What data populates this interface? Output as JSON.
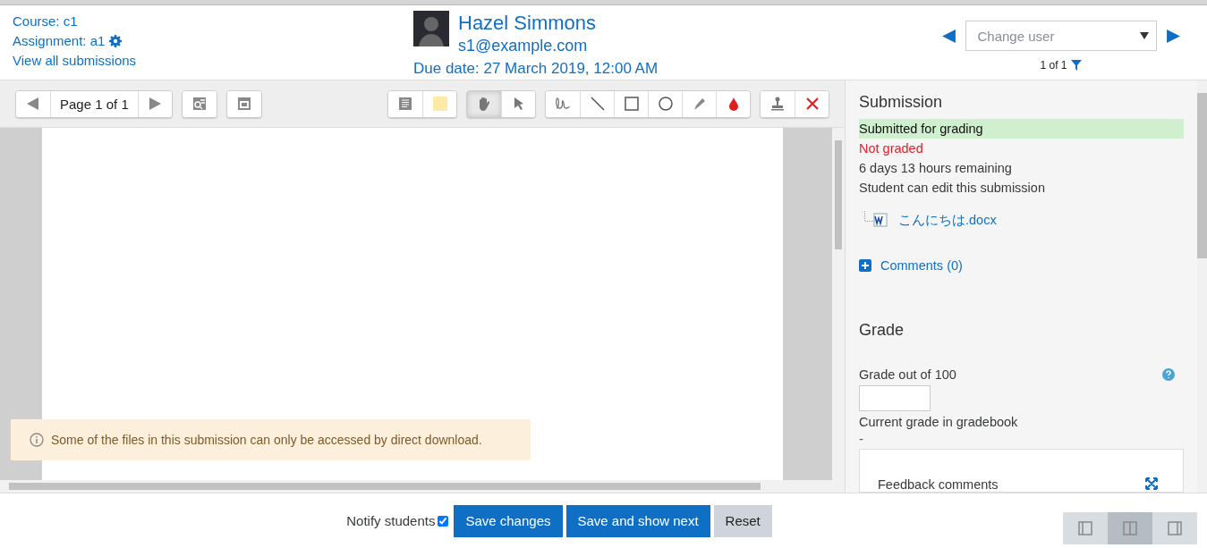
{
  "header": {
    "links": [
      {
        "text": "Course: c1"
      },
      {
        "text": "Assignment: a1",
        "settings": true
      },
      {
        "text": "View all submissions"
      }
    ],
    "user": {
      "name": "Hazel Simmons",
      "email": "s1@example.com",
      "due": "Due date: 27 March 2019, 12:00 AM"
    },
    "user_nav": {
      "placeholder": "Change user",
      "count": "1 of 1"
    }
  },
  "toolbar": {
    "page_label": "Page 1 of 1",
    "tool_groups": [
      [
        {
          "kind": "comment",
          "selected": false
        },
        {
          "kind": "swatch",
          "selected": false
        }
      ],
      [
        {
          "kind": "hand",
          "selected": true
        },
        {
          "kind": "pointer",
          "selected": false
        }
      ],
      [
        {
          "kind": "pen",
          "selected": false
        },
        {
          "kind": "line",
          "selected": false
        },
        {
          "kind": "rectangle",
          "selected": false
        },
        {
          "kind": "oval",
          "selected": false
        },
        {
          "kind": "highlighter",
          "selected": false
        },
        {
          "kind": "drop",
          "selected": false
        }
      ],
      [
        {
          "kind": "stamp",
          "selected": false
        },
        {
          "kind": "cross",
          "selected": false
        }
      ]
    ]
  },
  "notice": "Some of the files in this submission can only be accessed by direct download.",
  "submission": {
    "title": "Submission",
    "statuses": [
      {
        "text": "Submitted for grading",
        "kind": "success"
      },
      {
        "text": "Not graded",
        "kind": "danger"
      },
      {
        "text": "6 days 13 hours remaining",
        "kind": "plain"
      },
      {
        "text": "Student can edit this submission",
        "kind": "plain"
      }
    ],
    "file": "こんにちは.docx",
    "comments": "Comments (0)"
  },
  "grade": {
    "title": "Grade",
    "label": "Grade out of 100",
    "current_label": "Current grade in gradebook",
    "current_value": "-",
    "feedback_label": "Feedback comments"
  },
  "footer": {
    "notify_label": "Notify students",
    "notify_checked": true,
    "buttons": [
      {
        "label": "Save changes",
        "kind": "primary"
      },
      {
        "label": "Save and show next",
        "kind": "primary"
      },
      {
        "label": "Reset",
        "kind": "secondary"
      }
    ],
    "layouts": [
      {
        "kind": "left",
        "selected": false
      },
      {
        "kind": "both",
        "selected": true
      },
      {
        "kind": "right",
        "selected": false
      }
    ]
  }
}
